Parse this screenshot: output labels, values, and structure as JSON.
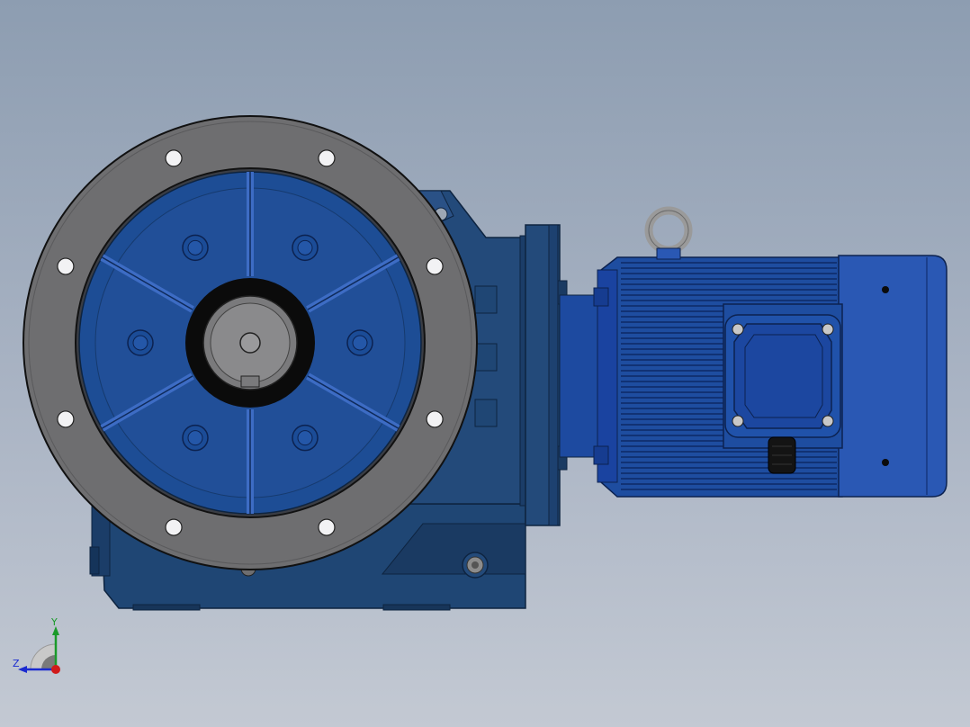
{
  "viewport": {
    "background_top": "#8d9db1",
    "background_bottom": "#c3c9d3"
  },
  "model": {
    "housing_color": "#234a7a",
    "housing_shadow": "#1a3a62",
    "flange_color": "#6e6e70",
    "bore_color": "#1d4d95",
    "motor_color": "#1e4da0",
    "motor_cap_color": "#2a58b4",
    "eyebolt_color": "#9a9a9a"
  },
  "triad": {
    "axes": [
      {
        "label": "Y",
        "color": "#1a9a2a",
        "icon": "y-axis-arrow"
      },
      {
        "label": "Z",
        "color": "#1a2ad0",
        "icon": "z-axis-arrow"
      },
      {
        "label": "X",
        "color": "#d01a1a",
        "icon": "x-axis-dot"
      }
    ]
  }
}
